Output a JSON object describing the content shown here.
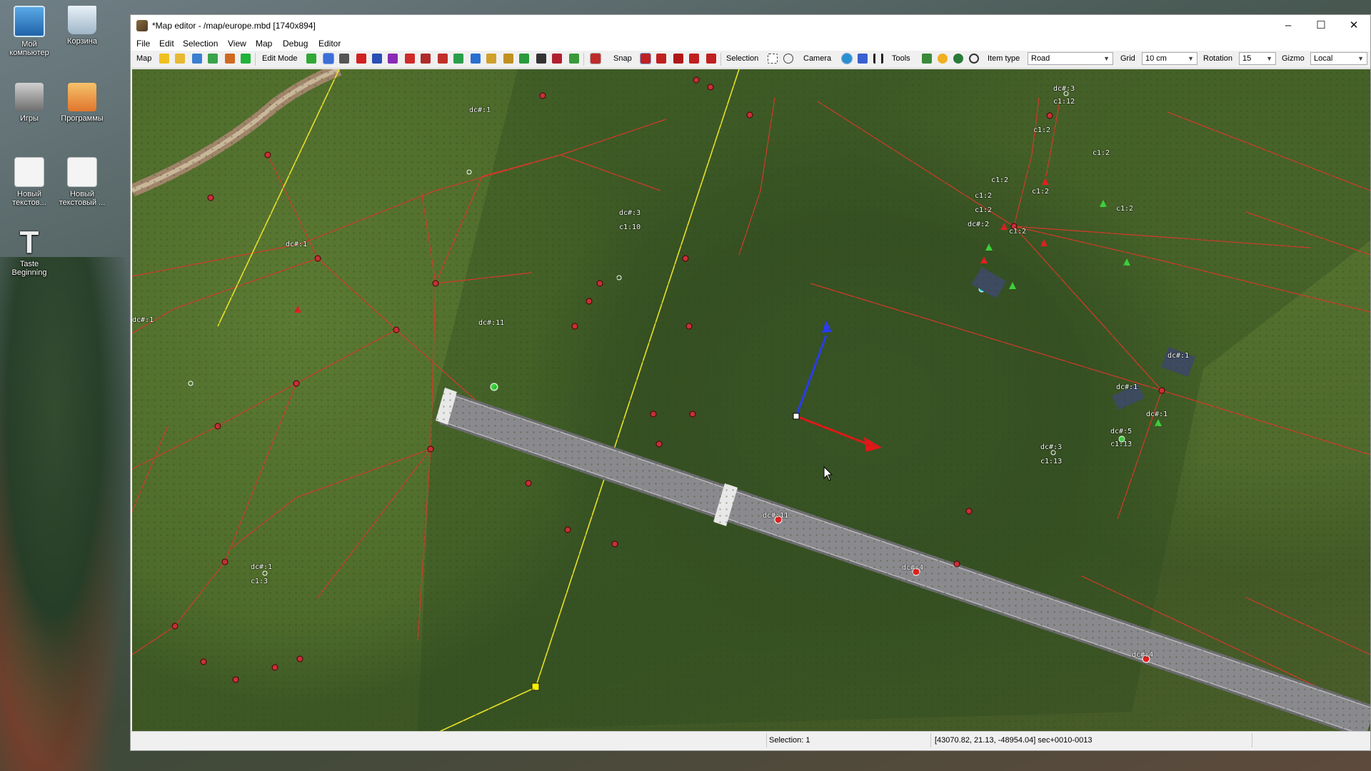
{
  "desktop": {
    "icons": [
      {
        "label": "Мой компьютер",
        "icon": "computer-icon"
      },
      {
        "label": "Корзина",
        "icon": "recycle-bin-icon"
      },
      {
        "label": "Игры",
        "icon": "games-folder-icon"
      },
      {
        "label": "Программы",
        "icon": "programs-folder-icon"
      },
      {
        "label": "Новый текстов...",
        "icon": "text-document-icon"
      },
      {
        "label": "Новый текстовый ...",
        "icon": "text-document-icon"
      },
      {
        "label": "Taste Beginning",
        "icon": "shortcut-icon"
      }
    ]
  },
  "window": {
    "title": "*Map editor - /map/europe.mbd [1740x894]",
    "controls": {
      "minimize": "–",
      "maximize": "☐",
      "close": "✕"
    }
  },
  "menu": [
    "File",
    "Edit",
    "Selection",
    "View",
    "Map",
    "Debug",
    "Editor"
  ],
  "toolbar": {
    "labels": {
      "map": "Map",
      "edit_mode": "Edit Mode",
      "snap": "Snap",
      "selection": "Selection",
      "camera": "Camera",
      "tools": "Tools",
      "item_type": "Item type",
      "grid": "Grid",
      "rotation": "Rotation",
      "gizmo": "Gizmo"
    },
    "item_type_value": "Road",
    "grid_value": "10 cm",
    "rotation_value": "15",
    "gizmo_value": "Local"
  },
  "map_labels": [
    {
      "text": "dc#:1",
      "id": "a"
    },
    {
      "text": "dc#:3",
      "id": "b"
    },
    {
      "text": "c1:10",
      "id": "c"
    },
    {
      "text": "dc#:1",
      "id": "d"
    },
    {
      "text": "dc#:1",
      "id": "e"
    },
    {
      "text": "dc#:11",
      "id": "f"
    },
    {
      "text": "dc#:11",
      "id": "g"
    },
    {
      "text": "dc#:4",
      "id": "h"
    },
    {
      "text": "dc#:4",
      "id": "i"
    },
    {
      "text": "dc#:1",
      "id": "j"
    },
    {
      "text": "c1:3",
      "id": "k"
    },
    {
      "text": "dc#:3",
      "id": "l"
    },
    {
      "text": "c1:12",
      "id": "m"
    },
    {
      "text": "c1:2",
      "id": "n"
    },
    {
      "text": "c1:2",
      "id": "o"
    },
    {
      "text": "c1:2",
      "id": "p"
    },
    {
      "text": "c1:2",
      "id": "q"
    },
    {
      "text": "c1:2",
      "id": "r"
    },
    {
      "text": "c1:2",
      "id": "s"
    },
    {
      "text": "dc#:2",
      "id": "t"
    },
    {
      "text": "c1:2",
      "id": "u"
    },
    {
      "text": "c1:2",
      "id": "v"
    },
    {
      "text": "dc#:1",
      "id": "w"
    },
    {
      "text": "dc#:1",
      "id": "x"
    },
    {
      "text": "dc#:1",
      "id": "y"
    },
    {
      "text": "dc#:5",
      "id": "z"
    },
    {
      "text": "c1:13",
      "id": "aa"
    },
    {
      "text": "dc#:3",
      "id": "ab"
    },
    {
      "text": "c1:13",
      "id": "ac"
    }
  ],
  "status": {
    "selection": "Selection: 1",
    "coords": "[43070.82, 21.13, -48954.04] sec+0010-0013"
  },
  "colors": {
    "road": "#77777a",
    "link_line": "#d33a2a",
    "yellow_line": "#e8e02a",
    "gizmo_x": "#e01818",
    "gizmo_y": "#2a3cf0",
    "node_green": "#3ccf3c",
    "node_red": "#e02020"
  }
}
